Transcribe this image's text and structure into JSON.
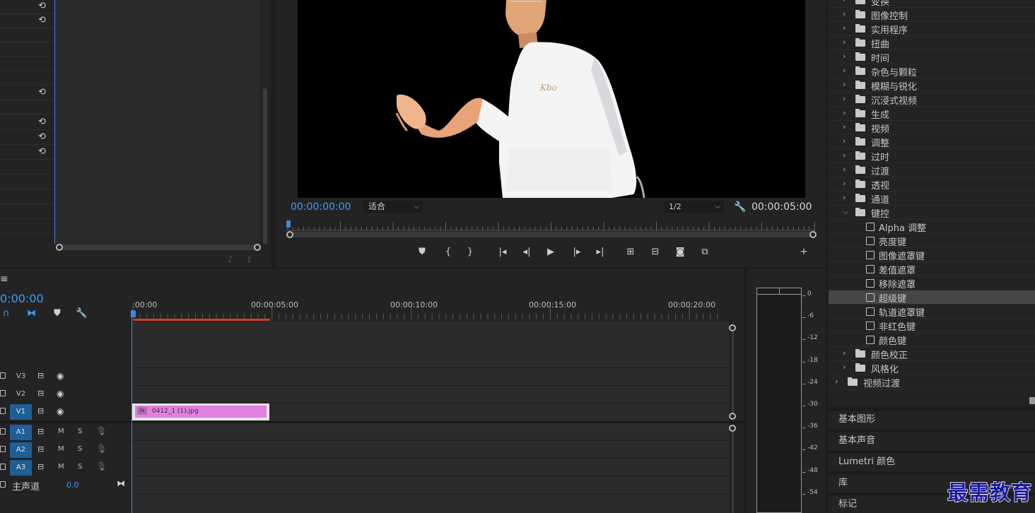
{
  "effect_controls": {
    "reset_icon_name": "reset-icon"
  },
  "monitor": {
    "timecode_current": "00:00:00:00",
    "fit_select": "适合",
    "resolution_select": "1/2",
    "timecode_duration": "00:00:05:00",
    "controls": [
      {
        "name": "add-marker-icon",
        "glyph": "⛊"
      },
      {
        "name": "mark-in-icon",
        "glyph": "{"
      },
      {
        "name": "mark-out-icon",
        "glyph": "}"
      },
      {
        "name": "go-to-in-icon",
        "glyph": "|◂"
      },
      {
        "name": "step-back-icon",
        "glyph": "◂|"
      },
      {
        "name": "play-icon",
        "glyph": "▶"
      },
      {
        "name": "step-forward-icon",
        "glyph": "|▸"
      },
      {
        "name": "go-to-out-icon",
        "glyph": "▸|"
      },
      {
        "name": "lift-icon",
        "glyph": "⊞"
      },
      {
        "name": "extract-icon",
        "glyph": "⊟"
      },
      {
        "name": "export-frame-icon",
        "glyph": "◙"
      },
      {
        "name": "comparison-view-icon",
        "glyph": "⧉"
      },
      {
        "name": "add-button-icon",
        "glyph": "+"
      }
    ]
  },
  "effects": {
    "items": [
      {
        "label": "变换",
        "type": "folder",
        "expanded": false
      },
      {
        "label": "图像控制",
        "type": "folder",
        "expanded": false
      },
      {
        "label": "实用程序",
        "type": "folder",
        "expanded": false
      },
      {
        "label": "扭曲",
        "type": "folder",
        "expanded": false
      },
      {
        "label": "时间",
        "type": "folder",
        "expanded": false
      },
      {
        "label": "杂色与颗粒",
        "type": "folder",
        "expanded": false
      },
      {
        "label": "模糊与锐化",
        "type": "folder",
        "expanded": false
      },
      {
        "label": "沉浸式视频",
        "type": "folder",
        "expanded": false
      },
      {
        "label": "生成",
        "type": "folder",
        "expanded": false
      },
      {
        "label": "视频",
        "type": "folder",
        "expanded": false
      },
      {
        "label": "调整",
        "type": "folder",
        "expanded": false
      },
      {
        "label": "过时",
        "type": "folder",
        "expanded": false
      },
      {
        "label": "过渡",
        "type": "folder",
        "expanded": false
      },
      {
        "label": "透视",
        "type": "folder",
        "expanded": false
      },
      {
        "label": "通道",
        "type": "folder",
        "expanded": false
      },
      {
        "label": "键控",
        "type": "folder",
        "expanded": true
      },
      {
        "label": "Alpha 调整",
        "type": "effect"
      },
      {
        "label": "亮度键",
        "type": "effect"
      },
      {
        "label": "图像遮罩键",
        "type": "effect"
      },
      {
        "label": "差值遮罩",
        "type": "effect"
      },
      {
        "label": "移除遮罩",
        "type": "effect"
      },
      {
        "label": "超级键",
        "type": "effect",
        "selected": true
      },
      {
        "label": "轨道遮罩键",
        "type": "effect"
      },
      {
        "label": "非红色键",
        "type": "effect"
      },
      {
        "label": "颜色键",
        "type": "effect"
      },
      {
        "label": "颜色校正",
        "type": "folder",
        "expanded": false
      },
      {
        "label": "风格化",
        "type": "folder",
        "expanded": false
      },
      {
        "label": "视频过渡",
        "type": "root-folder",
        "expanded": false
      }
    ]
  },
  "panels": {
    "essential_graphics": "基本图形",
    "essential_sound": "基本声音",
    "lumetri_color": "Lumetri 颜色",
    "libraries": "库",
    "markers": "标记"
  },
  "timeline": {
    "menu_icon": "≡",
    "timecode": "0:00:00",
    "ruler_labels": [
      ":00:00",
      "00:00:05:00",
      "00:00:10:00",
      "00:00:15:00",
      "00:00:20:00"
    ],
    "video_tracks": [
      {
        "name": "V3",
        "active": false
      },
      {
        "name": "V2",
        "active": false
      },
      {
        "name": "V1",
        "active": true
      }
    ],
    "audio_tracks": [
      {
        "name": "A1",
        "m": "M",
        "s": "S"
      },
      {
        "name": "A2",
        "m": "M",
        "s": "S"
      },
      {
        "name": "A3",
        "m": "M",
        "s": "S"
      }
    ],
    "master": {
      "label": "主声道",
      "value": "0.0"
    },
    "clip": {
      "name": "0412_1 (1).jpg",
      "fx": "fx"
    }
  },
  "meters": {
    "db_labels": [
      "0",
      "-6",
      "-12",
      "-18",
      "-24",
      "-30",
      "-36",
      "-42",
      "-48",
      "-54"
    ]
  },
  "watermark": "最需教育",
  "colors": {
    "accent_blue": "#3c9dff",
    "clip_pink": "#e27fe0",
    "work_area_red": "#d23b2c",
    "track_active": "#1f5e96"
  }
}
